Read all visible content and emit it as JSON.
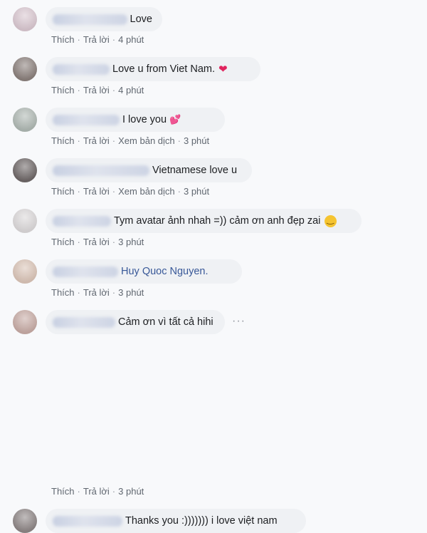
{
  "comments": [
    {
      "text": "Love",
      "emoji": "",
      "actions": [
        "Thích",
        "Trả lời"
      ],
      "time": "4 phút",
      "avatar_color": "#d8c6cf"
    },
    {
      "text": "Love u from Viet Nam.",
      "emoji": "❤",
      "actions": [
        "Thích",
        "Trả lời"
      ],
      "time": "4 phút",
      "avatar_color": "#8a7f7b"
    },
    {
      "text": "I love you",
      "emoji": "💕",
      "actions": [
        "Thích",
        "Trả lời",
        "Xem bản dịch"
      ],
      "time": "3 phút",
      "avatar_color": "#aeb7b2"
    },
    {
      "text": "Vietnamese love u",
      "emoji": "",
      "actions": [
        "Thích",
        "Trả lời",
        "Xem bản dịch"
      ],
      "time": "3 phút",
      "avatar_color": "#6e6767"
    },
    {
      "text": "Tym avatar ảnh nhah =)) cảm ơn anh đẹp zai",
      "emoji": "🙂",
      "actions": [
        "Thích",
        "Trả lời"
      ],
      "time": "3 phút",
      "avatar_color": "#dad7d8"
    },
    {
      "text": "Huy Quoc Nguyen.",
      "emoji": "",
      "actions": [
        "Thích",
        "Trả lời"
      ],
      "time": "3 phút",
      "avatar_color": "#d9c3b6"
    },
    {
      "text": "Cảm ơn vì tất cả hihi",
      "emoji": "",
      "actions": [],
      "time": "",
      "more": "···",
      "avatar_color": "#c6aaa4"
    },
    {
      "text": "",
      "emoji": "",
      "actions": [
        "Thích",
        "Trả lời"
      ],
      "time": "3 phút",
      "avatar_color": ""
    },
    {
      "text": "Thanks you :))))))) i love việt nam",
      "emoji": "",
      "actions": [],
      "time": "",
      "avatar_color": "#8d8585"
    }
  ]
}
